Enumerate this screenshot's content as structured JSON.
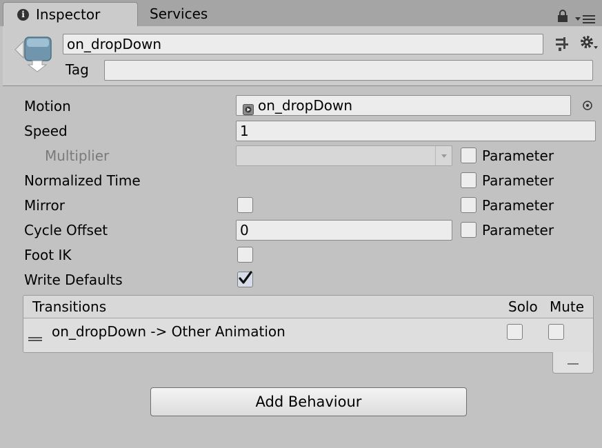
{
  "tabs": {
    "inspector": "Inspector",
    "services": "Services"
  },
  "header": {
    "name": "on_dropDown",
    "tag_label": "Tag",
    "tag_value": ""
  },
  "props": {
    "motion_label": "Motion",
    "motion_value": "on_dropDown",
    "speed_label": "Speed",
    "speed_value": "1",
    "multiplier_label": "Multiplier",
    "multiplier_value": "",
    "normalized_time_label": "Normalized Time",
    "mirror_label": "Mirror",
    "cycle_offset_label": "Cycle Offset",
    "cycle_offset_value": "0",
    "foot_ik_label": "Foot IK",
    "write_defaults_label": "Write Defaults",
    "parameter_label": "Parameter",
    "mirror_checked": false,
    "foot_ik_checked": false,
    "write_defaults_checked": true
  },
  "transitions": {
    "title": "Transitions",
    "solo_header": "Solo",
    "mute_header": "Mute",
    "rows": [
      {
        "label": "on_dropDown -> Other Animation",
        "solo": false,
        "mute": false
      }
    ],
    "remove_symbol": "—"
  },
  "add_behaviour_label": "Add Behaviour",
  "icons": [
    "info-icon",
    "lock-icon",
    "tab-menu-icon",
    "animator-state-icon",
    "preset-icon",
    "gear-icon",
    "animation-clip-icon",
    "object-picker-icon",
    "dropdown-arrow-icon",
    "checkmark-icon",
    "drag-handle-icon"
  ],
  "colors": {
    "panel_bg": "#c2c2c2",
    "tab_bar_bg": "#a5a5a5",
    "field_bg": "#ececec"
  }
}
